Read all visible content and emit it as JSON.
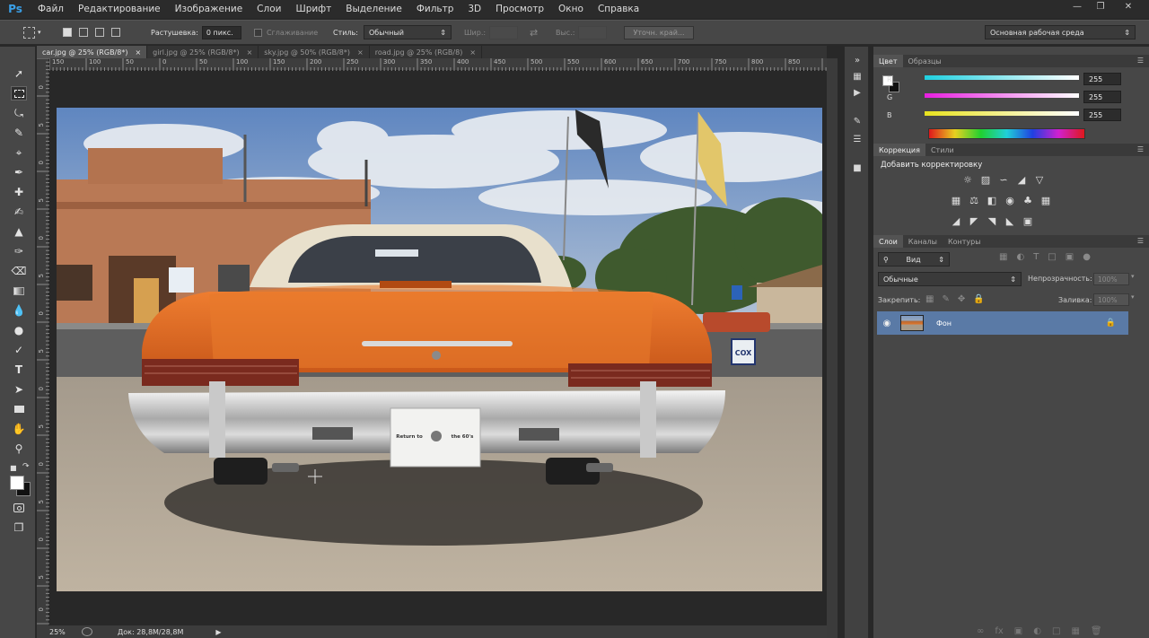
{
  "app": {
    "logo": "Ps"
  },
  "menu": [
    "Файл",
    "Редактирование",
    "Изображение",
    "Слои",
    "Шрифт",
    "Выделение",
    "Фильтр",
    "3D",
    "Просмотр",
    "Окно",
    "Справка"
  ],
  "options": {
    "feather_label": "Растушевка:",
    "feather_value": "0 пикс.",
    "antialias_label": "Сглаживание",
    "style_label": "Стиль:",
    "style_value": "Обычный",
    "width_label": "Шир.:",
    "height_label": "Выс.:",
    "refine_button": "Уточн. край...",
    "workspace": "Основная рабочая среда"
  },
  "doc_tabs": [
    {
      "label": "car.jpg @ 25% (RGB/8*)",
      "active": true
    },
    {
      "label": "girl.jpg @ 25% (RGB/8*)",
      "active": false
    },
    {
      "label": "sky.jpg @ 50% (RGB/8*)",
      "active": false
    },
    {
      "label": "road.jpg @ 25% (RGB/8)",
      "active": false
    }
  ],
  "ruler_h": [
    "150",
    "100",
    "50",
    "0",
    "50",
    "100",
    "150",
    "200",
    "250",
    "300",
    "350",
    "400",
    "450",
    "500",
    "550",
    "600",
    "650",
    "700",
    "750",
    "800",
    "850"
  ],
  "ruler_v": [
    "0",
    "5",
    "0",
    "5",
    "0",
    "5",
    "0",
    "5",
    "0",
    "5",
    "0",
    "5",
    "0",
    "5",
    "0"
  ],
  "status": {
    "zoom": "25%",
    "doc": "Док: 28,8M/28,8M"
  },
  "photo": {
    "plate_text_left": "Return to",
    "plate_text_right": "the 60's",
    "sign_text": "COX"
  },
  "color_panel": {
    "tabs": [
      "Цвет",
      "Образцы"
    ],
    "channels": [
      {
        "label": "R",
        "value": "255"
      },
      {
        "label": "G",
        "value": "255"
      },
      {
        "label": "B",
        "value": "255"
      }
    ]
  },
  "adjust_panel": {
    "tabs": [
      "Коррекция",
      "Стили"
    ],
    "title": "Добавить корректировку"
  },
  "layers_panel": {
    "tabs": [
      "Слои",
      "Каналы",
      "Контуры"
    ],
    "filter": "Вид",
    "blend_mode": "Обычные",
    "opacity_label": "Непрозрачность:",
    "opacity_value": "100%",
    "lock_label": "Закрепить:",
    "fill_label": "Заливка:",
    "fill_value": "100%",
    "layer_name": "Фон"
  },
  "colors": {
    "accent": "#5a7aa6",
    "ps_blue": "#3aa0e8",
    "car_orange": "#e0681e"
  }
}
